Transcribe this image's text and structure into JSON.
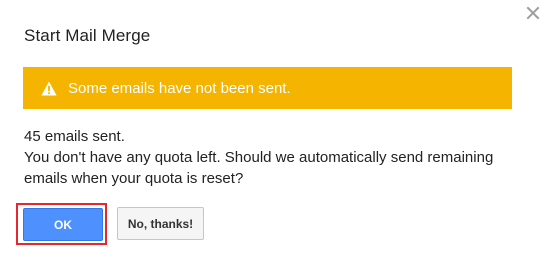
{
  "dialog": {
    "title": "Start Mail Merge",
    "close_icon": "close-icon"
  },
  "alert": {
    "icon": "warning-icon",
    "text": "Some emails have not been sent.",
    "background_color": "#f4b400"
  },
  "message": {
    "line1": "45 emails sent.",
    "line2": "You don't have any quota left. Should we automatically send remaining",
    "line3": "emails when your quota is reset?"
  },
  "buttons": {
    "ok_label": "OK",
    "no_label": "No, thanks!",
    "ok_color": "#4d90fe",
    "focus_ring_color": "#e8262b"
  }
}
